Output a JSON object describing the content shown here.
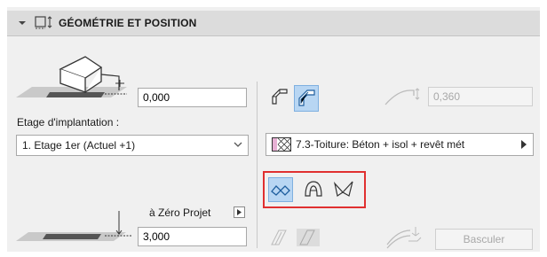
{
  "header": {
    "title": "GÉOMÉTRIE ET POSITION"
  },
  "top": {
    "offset_value": "0,000",
    "story_label": "Etage d'implantation :",
    "story_selected": "1. Etage 1er (Actuel +1)"
  },
  "bottom": {
    "reference_label": "à Zéro Projet",
    "height_value": "3,000"
  },
  "right": {
    "thickness_value": "0,360",
    "composite_label": "7.3-Toiture: Béton + isol + revêt mét",
    "swap_button": "Basculer"
  },
  "colors": {
    "highlight_border": "#e03030",
    "toggle_on": "#b8d6f3"
  }
}
